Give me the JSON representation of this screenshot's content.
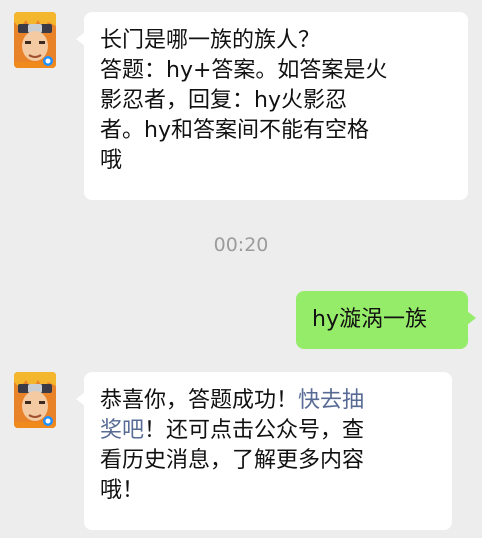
{
  "messages": [
    {
      "sender": "official-account",
      "lines": [
        "长门是哪一族的族人？",
        "答题：hy+答案。如答案是火",
        "影忍者，回复：hy火影忍",
        "者。hy和答案间不能有空格",
        "哦"
      ]
    },
    {
      "type": "timestamp",
      "text": "00:20"
    },
    {
      "sender": "me",
      "text": "hy漩涡一族"
    },
    {
      "sender": "official-account",
      "lines": {
        "l1_plain": "恭喜你，答题成功！",
        "l1_link": "快去抽",
        "l2_link": "奖吧",
        "l2_plain": "！还可点击公众号，查",
        "l3": "看历史消息，了解更多内容",
        "l4": "哦！"
      }
    }
  ],
  "colors": {
    "background": "#ededed",
    "incoming_bubble": "#ffffff",
    "outgoing_bubble": "#95ec69",
    "link": "#576b95",
    "timestamp": "#9c9c9c"
  },
  "icons": {
    "avatar": "naruto-game-avatar-icon"
  }
}
